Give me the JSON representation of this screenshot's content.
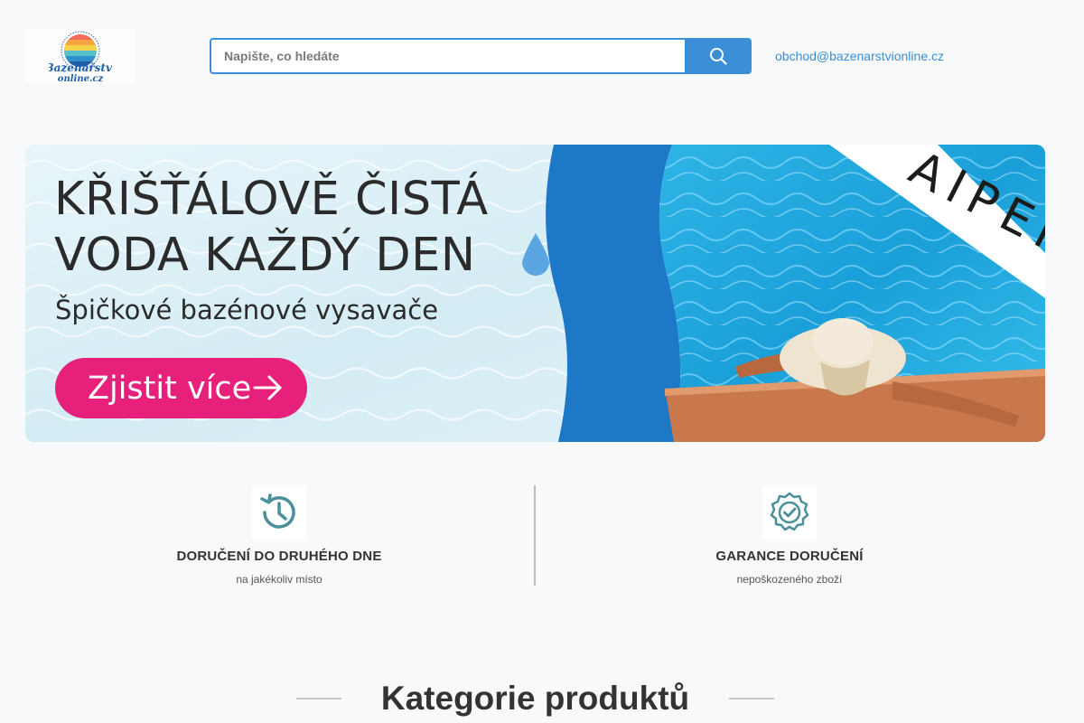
{
  "header": {
    "logo_text_line1": "Bazénářství",
    "logo_text_line2": "online.cz",
    "logo_ring_text": "NEJLEPŠÍ BAZÉNOVÉ VYBAVENÍ",
    "search_placeholder": "Napište, co hledáte",
    "email": "obchod@bazenarstvionline.cz"
  },
  "banner": {
    "title_line1": "KŘIŠŤÁLOVĚ ČISTÁ",
    "title_line2": "VODA KAŽDÝ DEN",
    "subtitle": "Špičkové bazénové vysavače",
    "cta_label": "Zjistit více",
    "brand": "AIPER",
    "cta_color": "#e6207b"
  },
  "features": [
    {
      "icon": "history-clock-icon",
      "title": "DORUČENÍ DO DRUHÉHO DNE",
      "subtitle": "na jakékoliv místo"
    },
    {
      "icon": "badge-check-icon",
      "title": "GARANCE DORUČENÍ",
      "subtitle": "nepoškozeného zboží"
    }
  ],
  "categories": {
    "heading": "Kategorie produktů"
  },
  "colors": {
    "accent": "#3a8fd6",
    "icon": "#4a8f99"
  }
}
